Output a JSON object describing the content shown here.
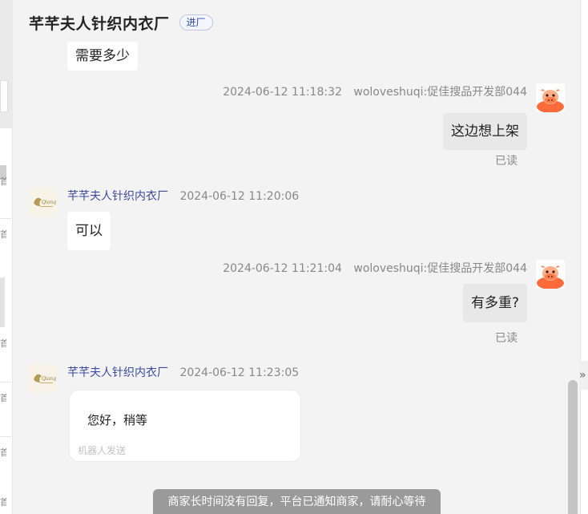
{
  "header": {
    "title": "芊芊夫人针织内衣厂",
    "tag": "进厂"
  },
  "left_strip": {
    "glyphs": [
      "首",
      "首",
      "首",
      "首",
      "首",
      "首"
    ]
  },
  "messages": [
    {
      "type": "incoming_text",
      "text": "需要多少"
    },
    {
      "type": "outgoing",
      "timestamp": "2024-06-12 11:18:32",
      "sender": "woloveshuqi:促佳搜品开发部044",
      "text": "这边想上架",
      "status": "已读"
    },
    {
      "type": "incoming",
      "name": "芊芊夫人针织内衣厂",
      "timestamp": "2024-06-12 11:20:06",
      "text": "可以"
    },
    {
      "type": "outgoing",
      "timestamp": "2024-06-12 11:21:04",
      "sender": "woloveshuqi:促佳搜品开发部044",
      "text": "有多重?",
      "status": "已读"
    },
    {
      "type": "incoming_card",
      "name": "芊芊夫人针织内衣厂",
      "timestamp": "2024-06-12 11:23:05",
      "text": "您好，稍等",
      "note": "机器人发送"
    }
  ],
  "notice": "商家长时间没有回复，平台已通知商家，请耐心等待",
  "icons": {
    "shop_avatar": "shop-logo-icon",
    "user_avatar": "cartoon-cow-avatar-icon",
    "collapse": "double-chevron-right-icon"
  },
  "colors": {
    "accent_name": "#3c4aa0",
    "bubble_self": "#e8e8e8",
    "notice_bg": "#9a9a9a"
  }
}
